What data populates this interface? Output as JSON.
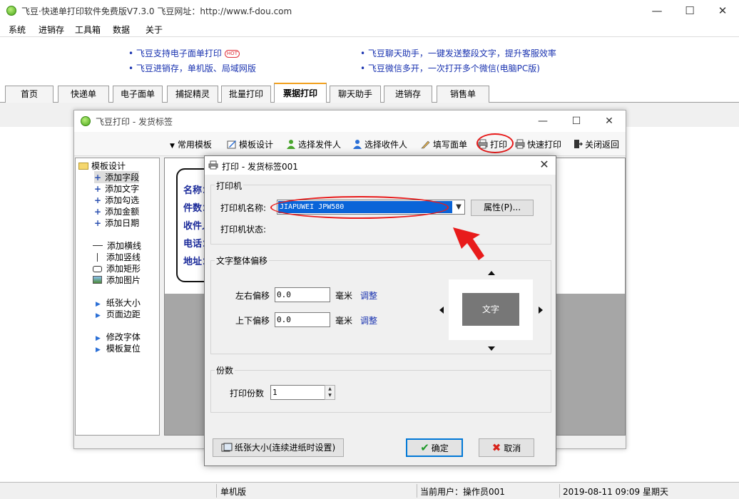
{
  "app": {
    "title": "飞豆·快递单打印软件免费版V7.3.0  飞豆网址：http://www.f-dou.com",
    "minimize": "—",
    "maximize": "☐",
    "close": "✕"
  },
  "menu": [
    "系统",
    "进销存",
    "工具箱",
    "数据",
    "关于"
  ],
  "promos": {
    "left": [
      "飞豆支持电子面单打印",
      "飞豆进销存，单机版、局域网版"
    ],
    "hot_badge": "HOT",
    "right": [
      "飞豆聊天助手，一键发送整段文字，提升客服效率",
      "飞豆微信多开，一次打开多个微信(电脑PC版)"
    ]
  },
  "tabs": [
    "首页",
    "快递单",
    "电子面单",
    "捕捉精灵",
    "批量打印",
    "票据打印",
    "聊天助手",
    "进销存",
    "销售单"
  ],
  "active_tab": "票据打印",
  "label_window": {
    "title": "飞豆打印 - 发货标签",
    "toolbar": [
      "常用模板",
      "模板设计",
      "选择发件人",
      "选择收件人",
      "填写面单",
      "打印",
      "快速打印",
      "关闭返回"
    ],
    "tree": {
      "root": "模板设计",
      "items": [
        "添加字段",
        "添加文字",
        "添加勾选",
        "添加金额",
        "添加日期",
        "添加横线",
        "添加竖线",
        "添加矩形",
        "添加图片",
        "纸张大小",
        "页面边距",
        "修改字体",
        "模板复位"
      ]
    },
    "label_fields": [
      "名称：",
      "件数：",
      "收件人",
      "电话：",
      "地址："
    ]
  },
  "print_dialog": {
    "title": "打印 - 发货标签001",
    "printer_group": "打印机",
    "printer_name_label": "打印机名称:",
    "printer_name_value": "JIAPUWEI JPW580",
    "properties_button": "属性(P)...",
    "printer_status_label": "打印机状态:",
    "offset_group": "文字整体偏移",
    "lr_label": "左右偏移",
    "lr_value": "0.0",
    "ud_label": "上下偏移",
    "ud_value": "0.0",
    "unit": "毫米",
    "adjust_link": "调整",
    "preview_text": "文字",
    "copies_group": "份数",
    "copies_label": "打印份数",
    "copies_value": "1",
    "paper_button": "纸张大小(连续进纸时设置)",
    "ok_button": "确定",
    "cancel_button": "取消"
  },
  "status": {
    "mode": "单机版",
    "user": "当前用户：操作员001",
    "datetime": "2019-08-11 09:09 星期天"
  },
  "colors": {
    "annotation_red": "#e81b1b",
    "link_blue": "#1a33b0",
    "selection_blue": "#0a64d8",
    "active_tab_accent": "#f2a01d"
  }
}
